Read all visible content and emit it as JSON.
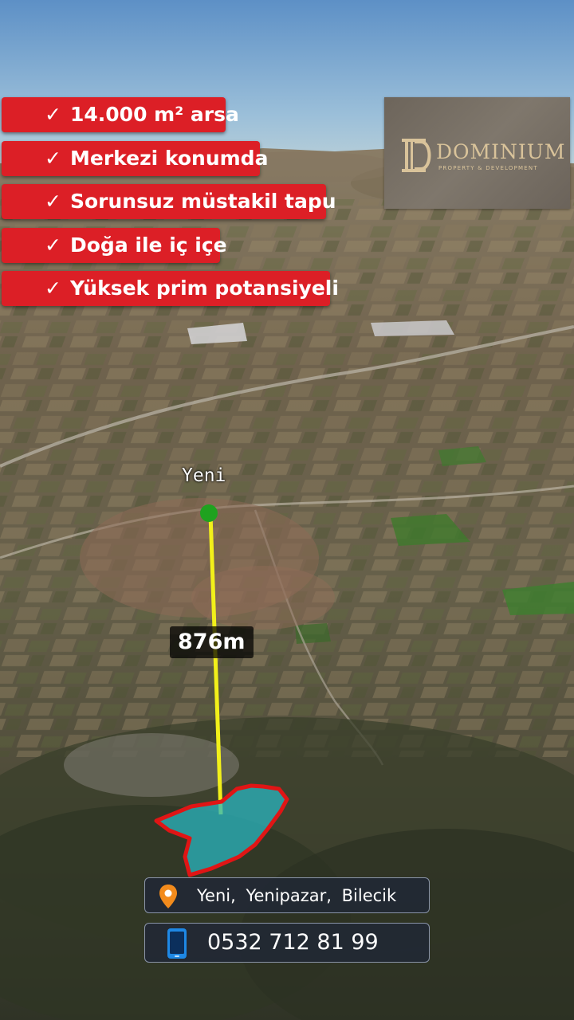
{
  "features": [
    {
      "check": "✓",
      "text": "14.000 m² arsa"
    },
    {
      "check": "✓",
      "text": "Merkezi konumda"
    },
    {
      "check": "✓",
      "text": "Sorunsuz müstakil tapu"
    },
    {
      "check": "✓",
      "text": "Doğa ile iç içe"
    },
    {
      "check": "✓",
      "text": "Yüksek prim potansiyeli"
    }
  ],
  "logo": {
    "name": "DOMINIUM",
    "subtitle": "PROPERTY & DEVELOPMENT"
  },
  "map": {
    "place_label": "Yeni",
    "distance": "876m"
  },
  "location": {
    "text": "Yeni,  Yenipazar,  Bilecik",
    "icon": "location-pin-icon"
  },
  "contact": {
    "phone": "0532 712 81 99",
    "icon": "smartphone-icon"
  },
  "colors": {
    "badge": "#dc1f26",
    "parcel_fill": "#2ab5c0",
    "parcel_border": "#e01515",
    "distance_line": "#f2f01a",
    "marker": "#1fa21f",
    "logo_gold": "#d9c39a"
  }
}
